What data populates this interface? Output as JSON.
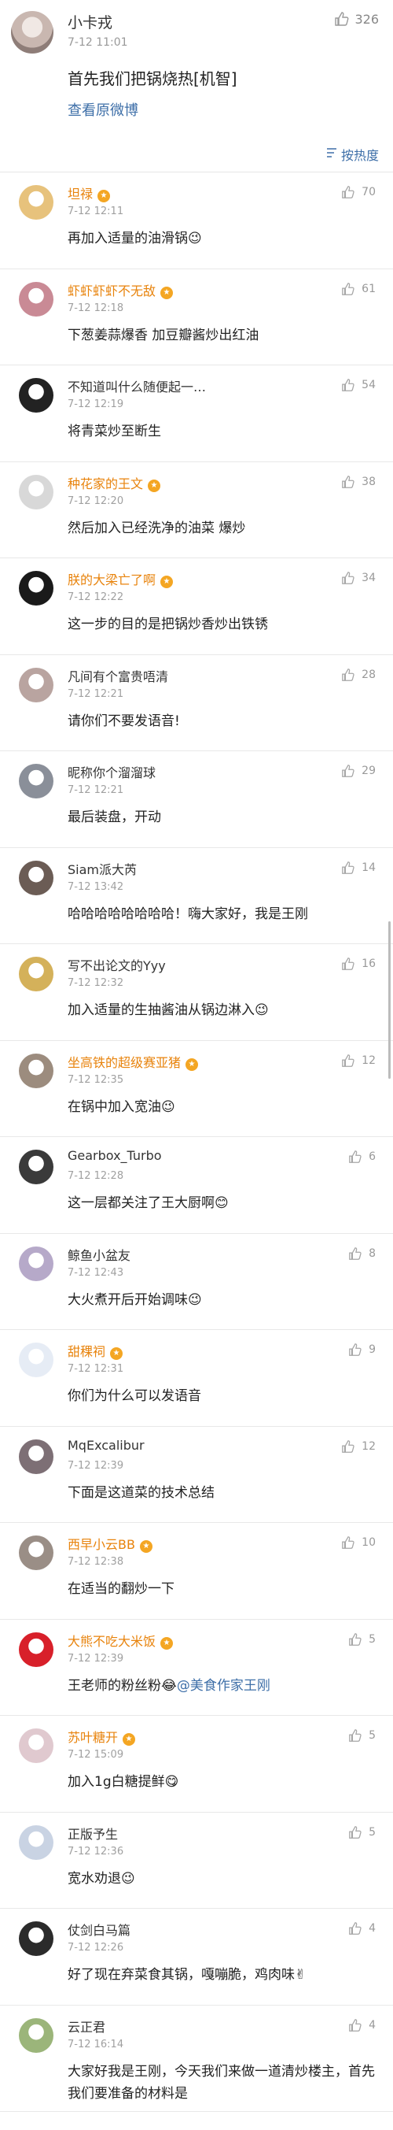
{
  "post": {
    "author": "小卡戎",
    "time": "7-12 11:01",
    "likes": "326",
    "text": "首先我们把锅烧热[机智]",
    "view_original": "查看原微博",
    "sort_label": "按热度"
  },
  "comments": [
    {
      "name": "坦禄",
      "time": "7-12 12:11",
      "text": "再加入适量的油滑锅😉",
      "likes": "70",
      "avatar": "#e7c27c"
    },
    {
      "name": "虾虾虾虾不无敌",
      "time": "7-12 12:18",
      "text": "下葱姜蒜爆香 加豆瓣酱炒出红油",
      "likes": "61",
      "avatar": "#c98a95"
    },
    {
      "name": "不知道叫什么随便起一…",
      "time": "7-12 12:19",
      "text": "将青菜炒至断生",
      "likes": "54",
      "avatar": "#222222"
    },
    {
      "name": "种花家的王文",
      "time": "7-12 12:20",
      "text": "然后加入已经洗净的油菜 爆炒",
      "likes": "38",
      "avatar": "#d8d8d8"
    },
    {
      "name": "朕的大梁亡了啊",
      "time": "7-12 12:22",
      "text": "这一步的目的是把锅炒香炒出铁锈",
      "likes": "34",
      "avatar": "#1a1a1a"
    },
    {
      "name": "凡间有个富贵唔清",
      "time": "7-12 12:21",
      "text": "请你们不要发语音!",
      "likes": "28",
      "avatar": "#b9a4a0"
    },
    {
      "name": "昵称你个溜溜球",
      "time": "7-12 12:21",
      "text": "最后装盘，开动",
      "likes": "29",
      "avatar": "#8a8f99"
    },
    {
      "name": "Siam派大芮",
      "time": "7-12 13:42",
      "text": "哈哈哈哈哈哈哈哈！嗨大家好，我是王刚",
      "likes": "14",
      "avatar": "#6b5c55"
    },
    {
      "name": "写不出论文的Yyy",
      "time": "7-12 12:32",
      "text": "加入适量的生抽酱油从锅边淋入😉",
      "likes": "16",
      "avatar": "#d4b15a"
    },
    {
      "name": "坐高铁的超级赛亚猪",
      "time": "7-12 12:35",
      "text": "在锅中加入宽油😉",
      "likes": "12",
      "avatar": "#9c8c7e"
    },
    {
      "name": "Gearbox_Turbo",
      "time": "7-12 12:28",
      "text": "这一层都关注了王大厨啊😊",
      "likes": "6",
      "avatar": "#3a3a3a"
    },
    {
      "name": "鲸鱼小盆友",
      "time": "7-12 12:43",
      "text": "大火煮开后开始调味😉",
      "likes": "8",
      "avatar": "#b6a9c9"
    },
    {
      "name": "甜稞祠",
      "time": "7-12 12:31",
      "text": "你们为什么可以发语音",
      "likes": "9",
      "avatar": "#e6ecf5"
    },
    {
      "name": "MqExcalibur",
      "time": "7-12 12:39",
      "text": "下面是这道菜的技术总结",
      "likes": "12",
      "avatar": "#7d6f75"
    },
    {
      "name": "西早小云BB",
      "time": "7-12 12:38",
      "text": "在适当的翻炒一下",
      "likes": "10",
      "avatar": "#9a8e86"
    },
    {
      "name": "大熊不吃大米饭",
      "time": "7-12 12:39",
      "text": "王老师的粉丝粉😂",
      "mention": "@美食作家王刚",
      "likes": "5",
      "avatar": "#d8202a"
    },
    {
      "name": "苏叶糖开",
      "time": "7-12 15:09",
      "text": "加入1g白糖提鲜😋",
      "likes": "5",
      "avatar": "#e0c9cf"
    },
    {
      "name": "正版予生",
      "time": "7-12 12:36",
      "text": "宽水劝退😉",
      "likes": "5",
      "avatar": "#c9d3e3"
    },
    {
      "name": "仗剑白马篇",
      "time": "7-12 12:26",
      "text": "好了现在弃菜食其锅，嘎嘣脆，鸡肉味✌",
      "likes": "4",
      "avatar": "#2b2b2b"
    },
    {
      "name": "云正君",
      "time": "7-12 16:14",
      "text": "大家好我是王刚，今天我们来做一道清炒楼主，首先我们要准备的材料是",
      "likes": "4",
      "avatar": "#9bb57a"
    }
  ],
  "vip_flags": [
    true,
    true,
    false,
    true,
    true,
    false,
    false,
    false,
    false,
    true,
    false,
    false,
    true,
    false,
    true,
    true,
    true,
    false,
    false,
    false
  ],
  "badge_icon": "vip-badge-icon",
  "colors": {
    "link": "#3e6fa8",
    "vip_name": "#e8830c",
    "time": "#a0a0a0"
  }
}
